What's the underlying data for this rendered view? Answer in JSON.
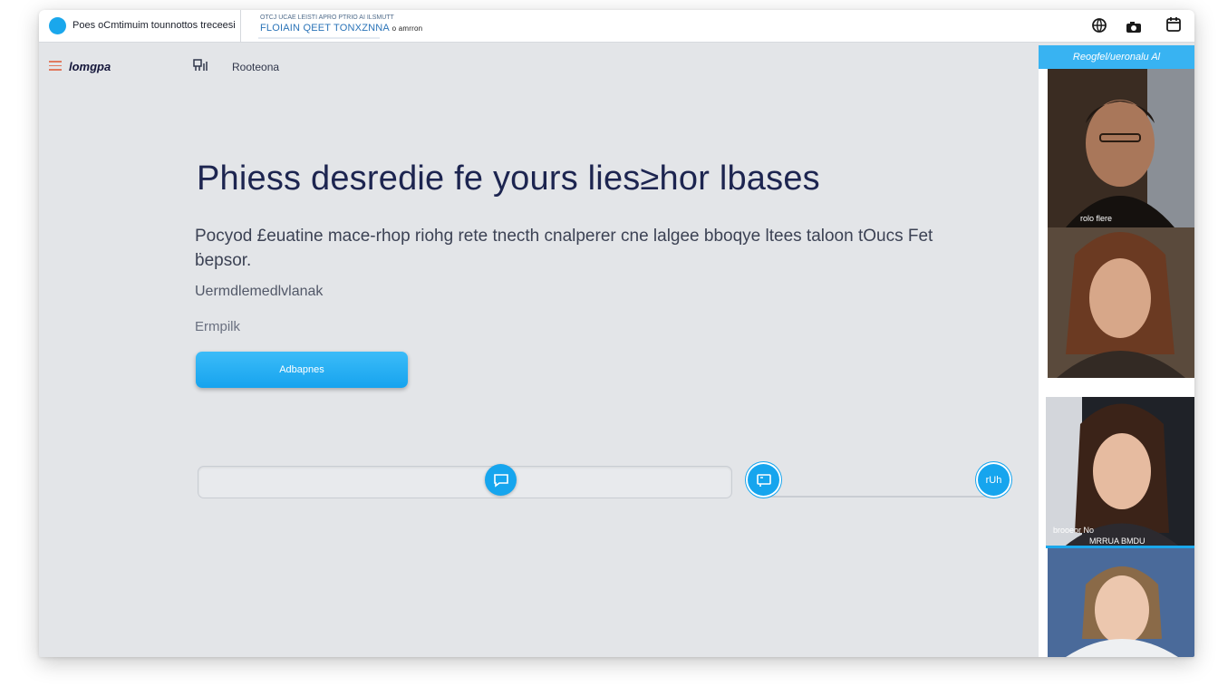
{
  "topbar": {
    "app_title": "Poes oCmtimuim tounnottos treceesi",
    "url_line1": "OTCJ UCAE LEISTI APRO PTRIO AI ILSMUTT",
    "url_line2": "FLOIAIN QEET TONXZNNA",
    "url_suffix": "o amrron"
  },
  "subnav": {
    "logo": "lomgpa",
    "nav_label": "Rooteona"
  },
  "hero": {
    "title": "Phiess desredie fe yours lies≥hor lbases",
    "description": "Pocyod £euatine mace-rhop riohg rete tnecth cnalperer cne lalgee bboqye ltees taloon tOucs Fet ḃepsor.",
    "subtitle": "Uermdlemedlvlanak",
    "field_label": "Ermpilk",
    "button_label": "Adbapnes"
  },
  "controls": {
    "right_button_label": "rUh"
  },
  "side_panel": {
    "header": "Reogfel/ueronalu Al",
    "tile1_caption": "rolo flere",
    "tile3_caption1": "brooeor No",
    "tile3_caption2": "MRRUA BMDU"
  },
  "colors": {
    "accent": "#16a5ee",
    "title_text": "#1d2550",
    "window_background": "#e3e5e8"
  },
  "icons": [
    "app-logo-icon",
    "menu-icon",
    "nav-grid-icon",
    "globe-icon",
    "camera-icon",
    "calendar-icon",
    "chat-icon",
    "message-icon"
  ]
}
